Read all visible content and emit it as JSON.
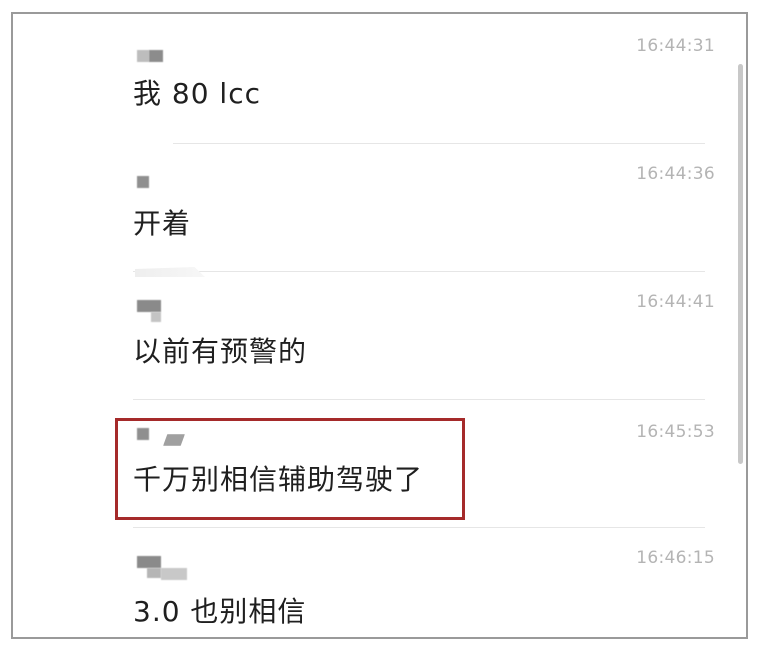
{
  "messages": [
    {
      "time": "16:44:31",
      "text": "我 80 lcc"
    },
    {
      "time": "16:44:36",
      "text": "开着"
    },
    {
      "time": "16:44:41",
      "text": "以前有预警的"
    },
    {
      "time": "16:45:53",
      "text": "千万别相信辅助驾驶了"
    },
    {
      "time": "16:46:15",
      "text": "3.0 也别相信"
    }
  ],
  "colors": {
    "highlight_border": "#a52a2a",
    "timestamp": "#b4b4b4",
    "message_text": "#1f1f1f"
  }
}
